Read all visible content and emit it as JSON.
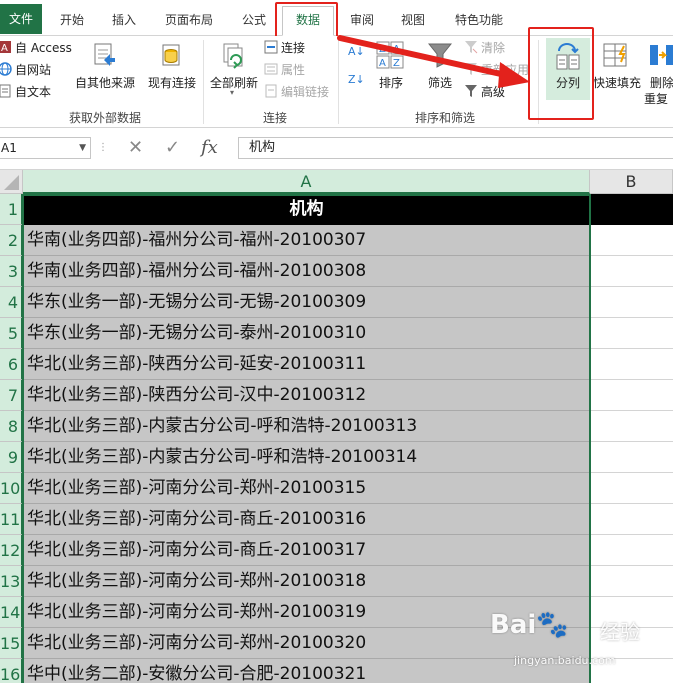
{
  "tabs": [
    {
      "label": "文件"
    },
    {
      "label": "开始"
    },
    {
      "label": "插入"
    },
    {
      "label": "页面布局"
    },
    {
      "label": "公式"
    },
    {
      "label": "数据"
    },
    {
      "label": "审阅"
    },
    {
      "label": "视图"
    },
    {
      "label": "特色功能"
    }
  ],
  "ribbon": {
    "external": {
      "from_access": "自 Access",
      "from_web": "自网站",
      "from_text": "自文本",
      "from_other": "自其他来源",
      "existing": "现有连接",
      "label": "获取外部数据"
    },
    "connections": {
      "refresh_all": "全部刷新",
      "connections": "连接",
      "properties": "属性",
      "edit_links": "编辑链接",
      "label": "连接"
    },
    "sortfilter": {
      "sort": "排序",
      "filter": "筛选",
      "clear": "清除",
      "reapply": "重新应用",
      "advanced": "高级",
      "label": "排序和筛选"
    },
    "tools": {
      "text_to_columns": "分列",
      "flash_fill": "快速填充",
      "remove_dup_1": "删除",
      "remove_dup_2": "重复"
    }
  },
  "formula_bar": {
    "name_box": "A1",
    "formula": "机构"
  },
  "columns": [
    "A",
    "B"
  ],
  "header_cell": "机构",
  "rows": [
    {
      "num": "1",
      "value": ""
    },
    {
      "num": "2",
      "value": "华南(业务四部)-福州分公司-福州-20100307"
    },
    {
      "num": "3",
      "value": "华南(业务四部)-福州分公司-福州-20100308"
    },
    {
      "num": "4",
      "value": "华东(业务一部)-无锡分公司-无锡-20100309"
    },
    {
      "num": "5",
      "value": "华东(业务一部)-无锡分公司-泰州-20100310"
    },
    {
      "num": "6",
      "value": "华北(业务三部)-陕西分公司-延安-20100311"
    },
    {
      "num": "7",
      "value": "华北(业务三部)-陕西分公司-汉中-20100312"
    },
    {
      "num": "8",
      "value": "华北(业务三部)-内蒙古分公司-呼和浩特-20100313"
    },
    {
      "num": "9",
      "value": "华北(业务三部)-内蒙古分公司-呼和浩特-20100314"
    },
    {
      "num": "10",
      "value": "华北(业务三部)-河南分公司-郑州-20100315"
    },
    {
      "num": "11",
      "value": "华北(业务三部)-河南分公司-商丘-20100316"
    },
    {
      "num": "12",
      "value": "华北(业务三部)-河南分公司-商丘-20100317"
    },
    {
      "num": "13",
      "value": "华北(业务三部)-河南分公司-郑州-20100318"
    },
    {
      "num": "14",
      "value": "华北(业务三部)-河南分公司-郑州-20100319"
    },
    {
      "num": "15",
      "value": "华北(业务三部)-河南分公司-郑州-20100320"
    },
    {
      "num": "16",
      "value": "华中(业务二部)-安徽分公司-合肥-20100321"
    }
  ],
  "watermark": {
    "brand": "Bai",
    "suffix": "经验",
    "url": "jingyan.baidu.com"
  },
  "colors": {
    "excel_green": "#217346",
    "highlight_red": "#e3221c",
    "selection_gray": "#c6c6c6",
    "header_black": "#000000"
  }
}
